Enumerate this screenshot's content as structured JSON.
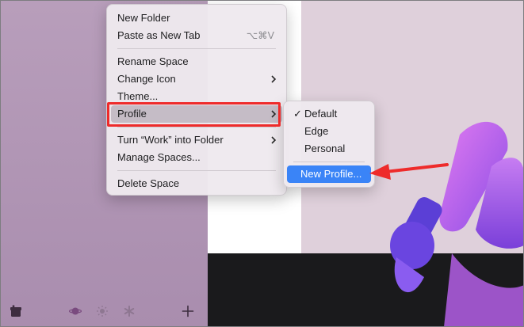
{
  "main_menu": {
    "items": [
      {
        "label": "New Folder"
      },
      {
        "label": "Paste as New Tab",
        "shortcut": "⌥⌘V"
      },
      {
        "label": "Rename Space"
      },
      {
        "label": "Change Icon"
      },
      {
        "label": "Theme..."
      },
      {
        "label": "Profile"
      },
      {
        "label": "Turn “Work” into Folder"
      },
      {
        "label": "Manage Spaces..."
      },
      {
        "label": "Delete Space"
      }
    ]
  },
  "profile_submenu": {
    "items": [
      {
        "label": "Default",
        "checked": true
      },
      {
        "label": "Edge"
      },
      {
        "label": "Personal"
      },
      {
        "label": "New Profile..."
      }
    ]
  },
  "toolbar": {
    "icons": [
      "archive-icon",
      "planet-icon",
      "sun-icon",
      "asterisk-icon",
      "plus-icon"
    ]
  },
  "colors": {
    "callout_red": "#ee2b2b",
    "highlight_blue": "#3a84f7",
    "sidebar_purple": "#b89ebb"
  }
}
